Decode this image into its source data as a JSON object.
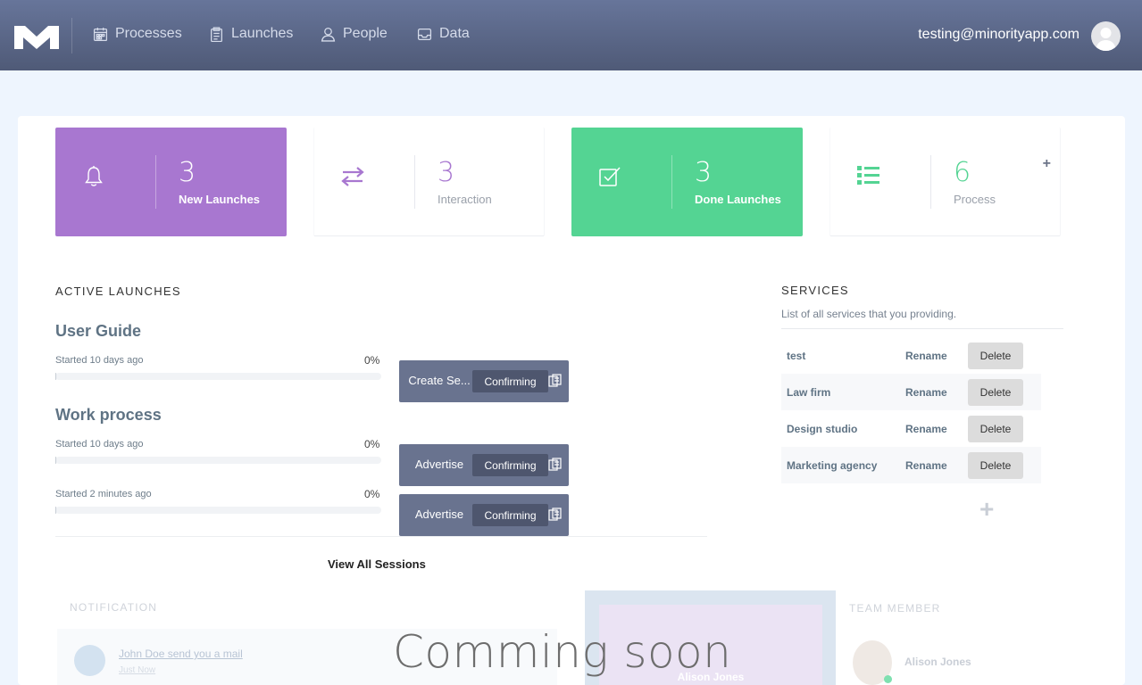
{
  "nav": {
    "items": [
      {
        "label": "Processes",
        "icon": "calendar-icon"
      },
      {
        "label": "Launches",
        "icon": "clipboard-icon"
      },
      {
        "label": "People",
        "icon": "person-icon"
      },
      {
        "label": "Data",
        "icon": "inbox-icon"
      }
    ],
    "user_email": "testing@minorityapp.com"
  },
  "stats": [
    {
      "value": "3",
      "label": "New Launches",
      "icon": "bell-icon",
      "color": "#a877d0"
    },
    {
      "value": "3",
      "label": "Interaction",
      "icon": "exchange-icon",
      "color": "#a877d0"
    },
    {
      "value": "3",
      "label": "Done Launches",
      "icon": "check-square-icon",
      "color": "#54d493"
    },
    {
      "value": "6",
      "label": "Process",
      "icon": "list-icon",
      "color": "#54d493",
      "action": "+"
    }
  ],
  "active_launches": {
    "title": "ACTIVE LAUNCHES",
    "launches": [
      {
        "name": "User Guide",
        "rows": [
          {
            "started": "Started 10 days ago",
            "percent": "0%",
            "progress": 0,
            "step": "Create Se...",
            "status": "Confirming"
          }
        ]
      },
      {
        "name": "Work process",
        "rows": [
          {
            "started": "Started 10 days ago",
            "percent": "0%",
            "progress": 0,
            "step": "Advertise",
            "status": "Confirming"
          },
          {
            "started": "Started 2 minutes ago",
            "percent": "0%",
            "progress": 0,
            "step": "Advertise",
            "status": "Confirming"
          }
        ]
      }
    ],
    "view_all": "View All Sessions"
  },
  "services": {
    "title": "SERVICES",
    "subtitle": "List of all services that you providing.",
    "rename_label": "Rename",
    "delete_label": "Delete",
    "add_label": "+",
    "items": [
      "test",
      "Law firm",
      "Design studio",
      "Marketing agency"
    ]
  },
  "notification": {
    "title": "NOTIFICATION",
    "text": "John Doe send you a mail",
    "time": "Just Now"
  },
  "profile": {
    "name": "Alison Jones"
  },
  "team": {
    "title": "TEAM MEMBER",
    "member": "Alison Jones"
  },
  "overlay": {
    "text": "Comming soon"
  },
  "colors": {
    "topbar": "#5b6685",
    "purple": "#a877d0",
    "green": "#54d493",
    "step": "#69738f"
  }
}
